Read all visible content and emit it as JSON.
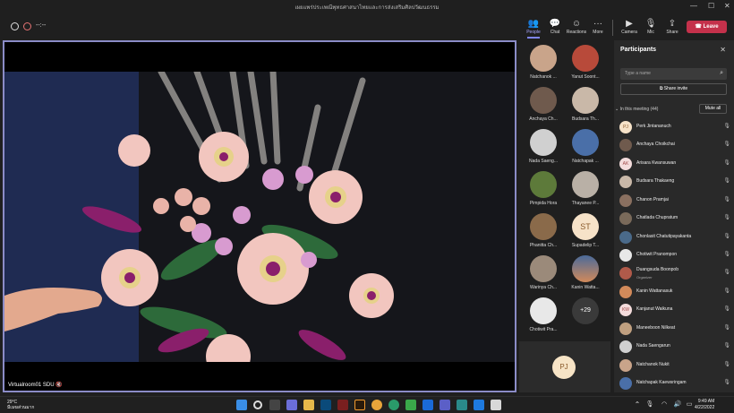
{
  "window": {
    "title": "เผยแพร่ประเพณีพุทธศาสนาไทยและการส่งเสริมศิลปวัฒนธรรม",
    "minimize": "—",
    "maximize": "☐",
    "close": "✕"
  },
  "toolbar": {
    "timer": "--:--",
    "people": {
      "label": "People",
      "icon": "people-icon"
    },
    "chat": {
      "label": "Chat",
      "icon": "chat-icon"
    },
    "reactions": {
      "label": "Reactions",
      "icon": "reactions-icon"
    },
    "more": {
      "label": "More",
      "icon": "more-icon"
    },
    "camera": {
      "label": "Camera",
      "icon": "camera-icon"
    },
    "mic": {
      "label": "Mic",
      "icon": "mic-muted-icon"
    },
    "share": {
      "label": "Share",
      "icon": "share-icon"
    },
    "leave": {
      "label": "Leave",
      "icon": "phone-hangup-icon"
    }
  },
  "stage": {
    "presenter_name": "Virtualroom01 SDU"
  },
  "gallery": {
    "tiles": [
      {
        "name": "Natchanok ...",
        "color": "#c9a48a"
      },
      {
        "name": "Yanut Soont...",
        "color": "#b84a3a"
      },
      {
        "name": "Anchaya Ch...",
        "color": "#6f5a4d"
      },
      {
        "name": "Budsara Th...",
        "color": "#c9b8a8"
      },
      {
        "name": "Nada Saeng...",
        "color": "#d0d0d0"
      },
      {
        "name": "Natchapak ...",
        "color": "#4a6fa8"
      },
      {
        "name": "Pimpida Hora",
        "color": "#5d7a3a"
      },
      {
        "name": "Thayanee P...",
        "color": "#b9b0a6"
      },
      {
        "name": "Phanitta Ch...",
        "color": "#8a6a4a"
      },
      {
        "name": "Supadelip T...",
        "color": "#f6e2c8",
        "initials": "ST"
      },
      {
        "name": "Warinya Ch...",
        "color": "#9b8a7a"
      },
      {
        "name": "Kanin Watta...",
        "color": "#d28a5a"
      },
      {
        "name": "Chotiwit Pra...",
        "color": "#e8e8e8"
      }
    ],
    "overflow_count": "+29",
    "self_initials": "PJ"
  },
  "participants_panel": {
    "title": "Participants",
    "search_placeholder": "Type a name",
    "share_invite": "Share invite",
    "section_label": "In this meeting (44)",
    "mute_all": "Mute all",
    "people": [
      {
        "name": "Perk Jintananuch",
        "initials": "PJ",
        "color": "#f6e2c8"
      },
      {
        "name": "Anchaya Choikchai",
        "initials": "",
        "color": "#6f5a4d"
      },
      {
        "name": "Arisara Kwansuwan",
        "initials": "AK",
        "color": "#f4dcdc"
      },
      {
        "name": "Budsara Thakaeng",
        "initials": "",
        "color": "#c9b8a8"
      },
      {
        "name": "Chanon Pramjai",
        "initials": "",
        "color": "#8a7060"
      },
      {
        "name": "Chatlada Chupratum",
        "initials": "",
        "color": "#7a6a5a"
      },
      {
        "name": "Chonlasit Chatutipayakanta",
        "initials": "",
        "color": "#4a6a8a"
      },
      {
        "name": "Chotiwit Pranompon",
        "initials": "",
        "color": "#e8e8e8"
      },
      {
        "name": "Duangsuda Boonpob",
        "initials": "",
        "role": "Organizer",
        "color": "#b05a4a"
      },
      {
        "name": "Kanin Wattanasuk",
        "initials": "",
        "color": "#d28a5a"
      },
      {
        "name": "Kanjanut Waikuna",
        "initials": "KW",
        "color": "#f4dcdc"
      },
      {
        "name": "Maneeboon Nilkeat",
        "initials": "",
        "color": "#c0a080"
      },
      {
        "name": "Nada Saengarun",
        "initials": "",
        "color": "#d0d0d0"
      },
      {
        "name": "Natchanok Nukit",
        "initials": "",
        "color": "#c9a48a"
      },
      {
        "name": "Natchapak Kaewsringam",
        "initials": "",
        "color": "#4a6fa8"
      }
    ]
  },
  "taskbar": {
    "weather_temp": "29°C",
    "weather_desc": "มีเมฆส่วนมาก",
    "time": "9:49 AM",
    "date": "4/22/2022"
  }
}
